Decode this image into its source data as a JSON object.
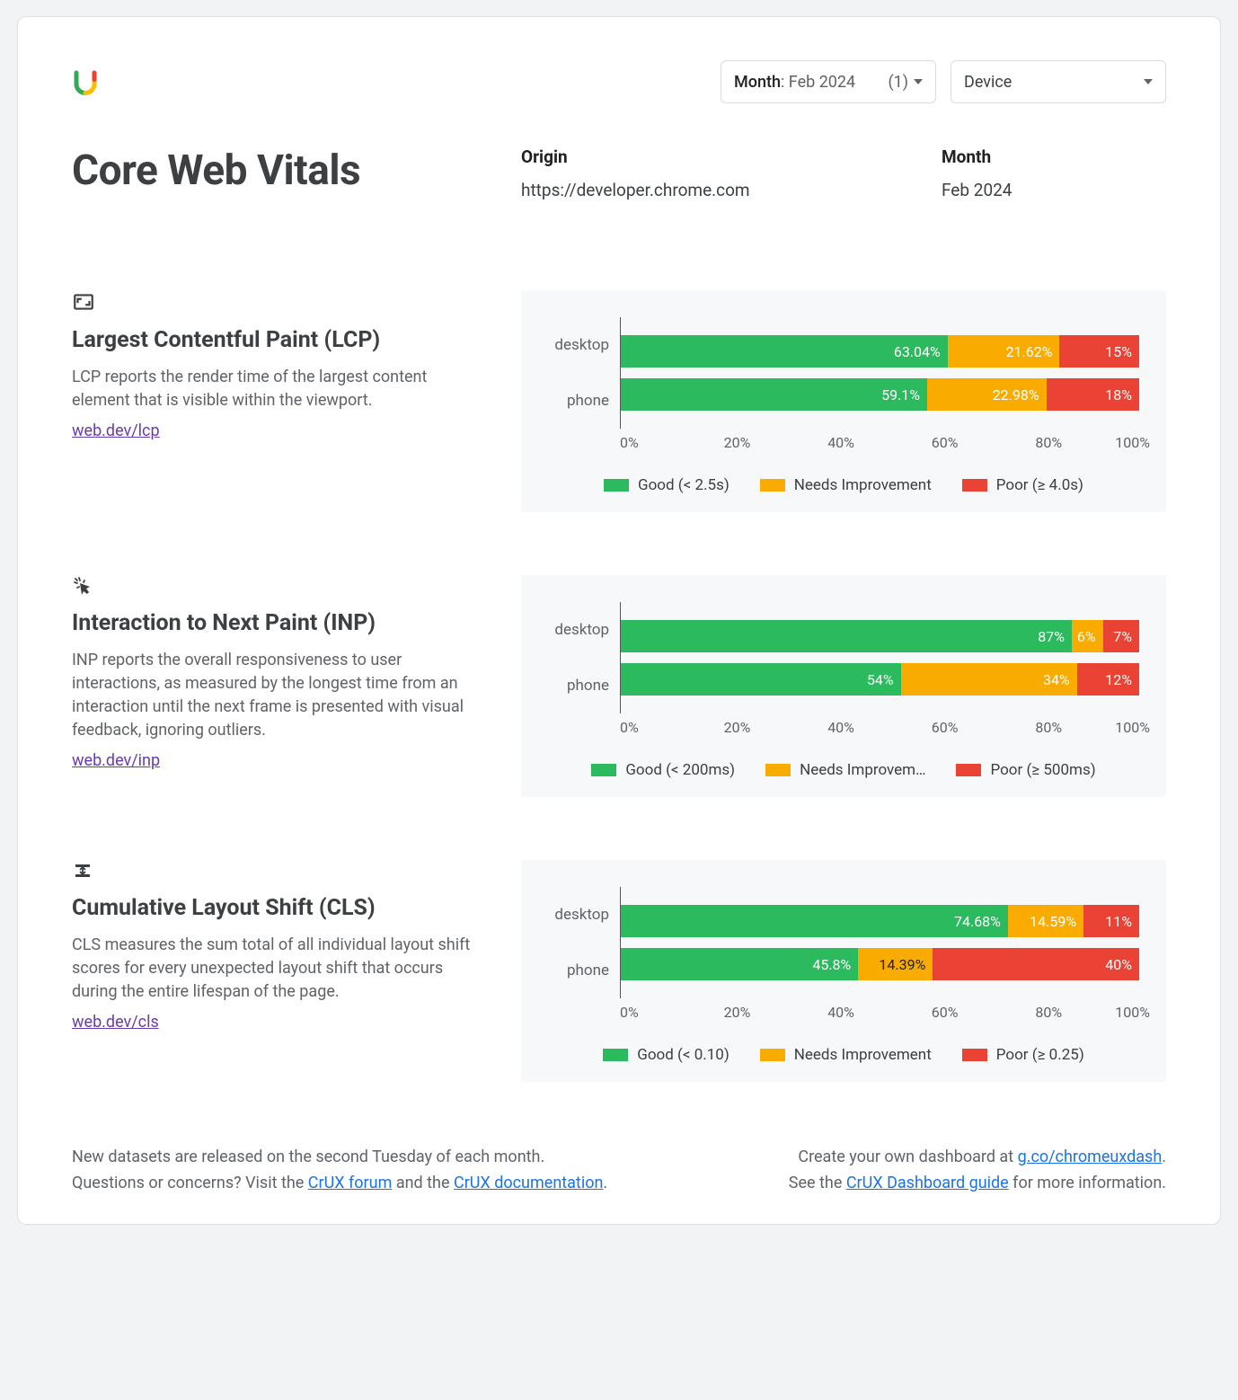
{
  "title": "Core Web Vitals",
  "filters": {
    "month_label": "Month",
    "month_value": ": Feb 2024",
    "month_count": "(1)",
    "device_label": "Device"
  },
  "origin": {
    "label": "Origin",
    "value": "https://developer.chrome.com"
  },
  "month": {
    "label": "Month",
    "value": "Feb 2024"
  },
  "metrics": [
    {
      "id": "lcp",
      "title": "Largest Contentful Paint (LCP)",
      "desc": "LCP reports the render time of the largest content element that is visible within the viewport.",
      "link": "web.dev/lcp",
      "legend": {
        "good": "Good (< 2.5s)",
        "ni": "Needs Improvement",
        "poor": "Poor (≥ 4.0s)"
      }
    },
    {
      "id": "inp",
      "title": "Interaction to Next Paint (INP)",
      "desc": "INP reports the overall responsiveness to user interactions, as measured by the longest time from an interaction until the next frame is presented with visual feedback, ignoring outliers.",
      "link": "web.dev/inp",
      "legend": {
        "good": "Good (< 200ms)",
        "ni": "Needs Improvem…",
        "poor": "Poor (≥ 500ms)"
      }
    },
    {
      "id": "cls",
      "title": "Cumulative Layout Shift (CLS)",
      "desc": "CLS measures the sum total of all individual layout shift scores for every unexpected layout shift that occurs during the entire lifespan of the page.",
      "link": "web.dev/cls",
      "legend": {
        "good": "Good (< 0.10)",
        "ni": "Needs Improvement",
        "poor": "Poor (≥ 0.25)"
      }
    }
  ],
  "xaxis": [
    "0%",
    "20%",
    "40%",
    "60%",
    "80%",
    "100%"
  ],
  "footer": {
    "left1a": "New datasets are released on the second Tuesday of each month.",
    "left2a": "Questions or concerns? Visit the ",
    "left2link1": "CrUX forum",
    "left2b": " and the ",
    "left2link2": "CrUX documentation",
    "left2c": ".",
    "right1a": "Create your own dashboard at ",
    "right1link": "g.co/chromeuxdash",
    "right1b": ".",
    "right2a": "See the ",
    "right2link": "CrUX Dashboard guide",
    "right2b": " for more information."
  },
  "chart_data": [
    {
      "metric": "LCP",
      "type": "bar",
      "stacked": true,
      "categories": [
        "desktop",
        "phone"
      ],
      "series": [
        {
          "name": "Good (< 2.5s)",
          "values": [
            63.04,
            59.1
          ],
          "labels": [
            "63.04%",
            "59.1%"
          ]
        },
        {
          "name": "Needs Improvement",
          "values": [
            21.62,
            22.98
          ],
          "labels": [
            "21.62%",
            "22.98%"
          ]
        },
        {
          "name": "Poor (≥ 4.0s)",
          "values": [
            15.34,
            17.92
          ],
          "labels": [
            "15%",
            "18%"
          ]
        }
      ],
      "xlim": [
        0,
        100
      ],
      "xlabel": "",
      "ylabel": ""
    },
    {
      "metric": "INP",
      "type": "bar",
      "stacked": true,
      "categories": [
        "desktop",
        "phone"
      ],
      "series": [
        {
          "name": "Good (< 200ms)",
          "values": [
            87,
            54
          ],
          "labels": [
            "87%",
            "54%"
          ]
        },
        {
          "name": "Needs Improvement",
          "values": [
            6,
            34
          ],
          "labels": [
            "6%",
            "34%"
          ]
        },
        {
          "name": "Poor (≥ 500ms)",
          "values": [
            7,
            12
          ],
          "labels": [
            "7%",
            "12%"
          ]
        }
      ],
      "xlim": [
        0,
        100
      ],
      "xlabel": "",
      "ylabel": ""
    },
    {
      "metric": "CLS",
      "type": "bar",
      "stacked": true,
      "categories": [
        "desktop",
        "phone"
      ],
      "series": [
        {
          "name": "Good (< 0.10)",
          "values": [
            74.68,
            45.8
          ],
          "labels": [
            "74.68%",
            "45.8%"
          ]
        },
        {
          "name": "Needs Improvement",
          "values": [
            14.59,
            14.39
          ],
          "labels": [
            "14.59%",
            "14.39%"
          ]
        },
        {
          "name": "Poor (≥ 0.25)",
          "values": [
            10.73,
            39.81
          ],
          "labels": [
            "11%",
            "40%"
          ]
        }
      ],
      "xlim": [
        0,
        100
      ],
      "xlabel": "",
      "ylabel": ""
    }
  ]
}
